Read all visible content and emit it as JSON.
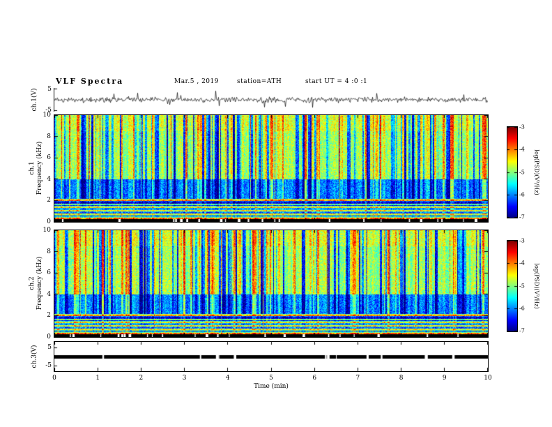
{
  "header": {
    "title": "VLF  Spectra",
    "date": "Mar.5 , 2019",
    "station": "station=ATH",
    "start_ut": "start UT = 4 :0 :1"
  },
  "xaxis": {
    "label": "Time (min)",
    "lim": [
      0,
      10
    ],
    "ticks": [
      "0",
      "1",
      "2",
      "3",
      "4",
      "5",
      "6",
      "7",
      "8",
      "9",
      "10"
    ]
  },
  "chart_data": [
    {
      "id": "ch1-waveform",
      "type": "line",
      "ylabel": "ch.1(V)",
      "ylim": [
        -5,
        5
      ],
      "yticks": [
        "5",
        "-5"
      ],
      "line_color": "#000000",
      "signal": "broadband noise about 0 V (~±1 V) with frequent impulsive spikes reaching ±4 V across the whole 0-10 min record"
    },
    {
      "id": "ch1-spectrogram",
      "type": "heatmap",
      "ylabel_line1": "ch.1",
      "ylabel_line2": "Frequency (kHz)",
      "ylim": [
        0,
        10
      ],
      "yticks": [
        "10",
        "8",
        "6",
        "4",
        "2",
        "0"
      ],
      "xlim": [
        0,
        10
      ],
      "zlim": [
        -7,
        -3
      ],
      "colormap": "jet",
      "appearance": "green/yellow background 4-10 kHz with dense vertical yellow-red sferic streaks and dark-blue dropout columns, dark blue band 2-4 kHz, layered red/cyan/black horizontal harmonic stripes below 2 kHz, black dashed strip at 0 kHz",
      "colorbar": {
        "ticks": [
          "-3",
          "-4",
          "-5",
          "-6",
          "-7"
        ],
        "label": "log(PSD)(V²/Hz)"
      }
    },
    {
      "id": "ch2-spectrogram",
      "type": "heatmap",
      "ylabel_line1": "ch.2",
      "ylabel_line2": "Frequency (kHz)",
      "ylim": [
        0,
        10
      ],
      "yticks": [
        "10",
        "8",
        "6",
        "4",
        "2",
        "0"
      ],
      "xlim": [
        0,
        10
      ],
      "zlim": [
        -7,
        -3
      ],
      "colormap": "jet",
      "appearance": "similar to ch.1: green/cyan field with vertical streaks, blue band near 2-4 kHz, horizontal stripe structure below 2 kHz, black dashed strip at 0 kHz",
      "colorbar": {
        "ticks": [
          "-3",
          "-4",
          "-5",
          "-6",
          "-7"
        ],
        "label": "log(PSD)(V²/Hz)"
      }
    },
    {
      "id": "ch3-waveform",
      "type": "line",
      "ylabel": "ch.3(V)",
      "ylim": [
        -5,
        5
      ],
      "yticks": [
        "5",
        "-5"
      ],
      "line_color": "#000000",
      "signal": "flat saturated trace rendered as a solid thick black band near 0 V with short white gaps"
    }
  ]
}
